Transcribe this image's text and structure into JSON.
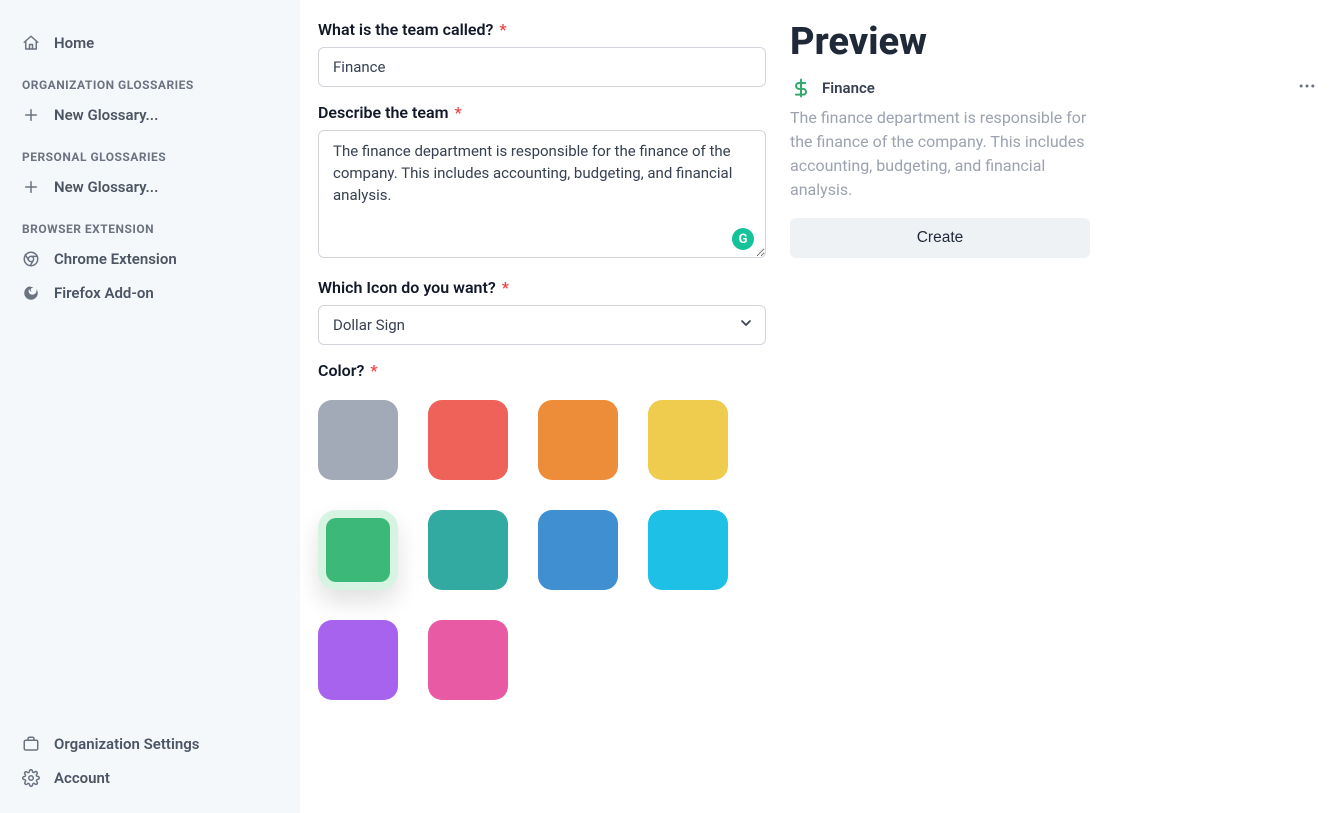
{
  "sidebar": {
    "home": "Home",
    "sections": {
      "org_title": "ORGANIZATION GLOSSARIES",
      "org_new": "New Glossary...",
      "personal_title": "PERSONAL GLOSSARIES",
      "personal_new": "New Glossary...",
      "ext_title": "BROWSER EXTENSION",
      "chrome": "Chrome Extension",
      "firefox": "Firefox Add-on"
    },
    "footer": {
      "org_settings": "Organization Settings",
      "account": "Account"
    }
  },
  "form": {
    "name_label": "What is the team called?",
    "name_value": "Finance",
    "desc_label": "Describe the team",
    "desc_value": "The finance department is responsible for the finance of the company. This includes accounting, budgeting, and financial analysis.",
    "icon_label": "Which Icon do you want?",
    "icon_value": "Dollar Sign",
    "color_label": "Color?",
    "grammarly_badge": "G",
    "colors": {
      "c0": "#a2aab8",
      "c1": "#ee6259",
      "c2": "#ed8d3a",
      "c3": "#efcb4e",
      "c4": "#3cb878",
      "c5": "#32a9a1",
      "c6": "#3f8fd1",
      "c7": "#1fc0e6",
      "c8": "#a763ed",
      "c9": "#e85aa4"
    },
    "selected_color_index": 4
  },
  "preview": {
    "title": "Preview",
    "name": "Finance",
    "desc": "The finance department is responsible for the finance of the company. This includes accounting, budgeting, and financial analysis.",
    "create_label": "Create"
  }
}
